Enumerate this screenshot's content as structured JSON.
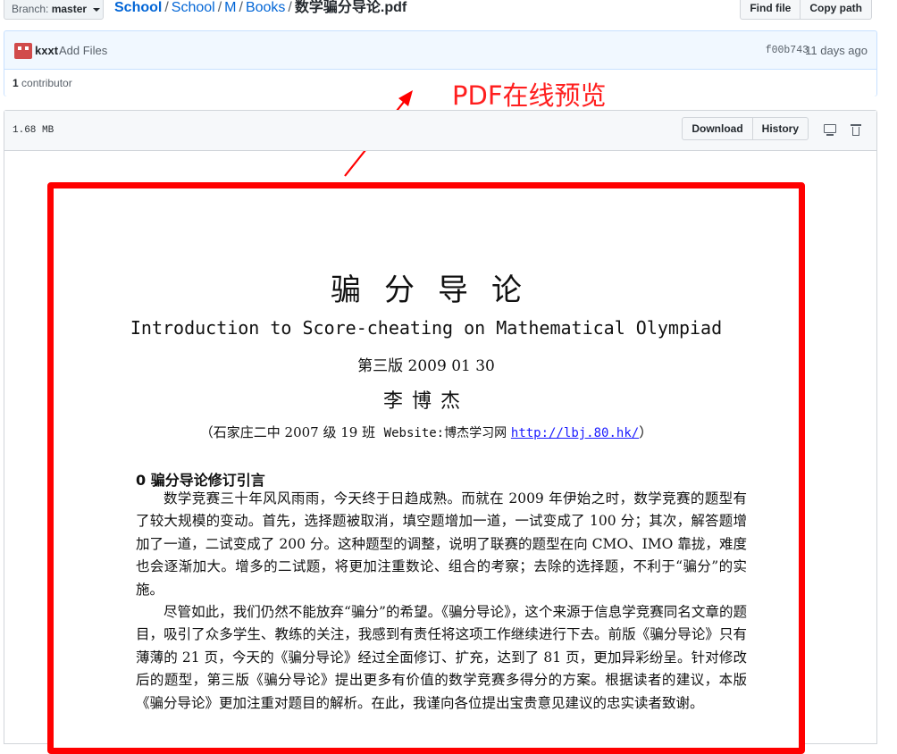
{
  "topbar": {
    "branch_prefix": "Branch:",
    "branch_name": "master",
    "breadcrumb_root": "School",
    "breadcrumb_items": [
      "School",
      "M",
      "Books"
    ],
    "breadcrumb_current": "数学骗分导论.pdf",
    "find_file_label": "Find file",
    "copy_path_label": "Copy path"
  },
  "commit": {
    "author": "kxxt",
    "message": "Add Files",
    "sha": "f00b743",
    "age": "11 days ago",
    "contributors_count": "1",
    "contributors_label": "contributor"
  },
  "file": {
    "size": "1.68 MB",
    "download_label": "Download",
    "history_label": "History",
    "icons": [
      "desktop-icon",
      "trash-icon"
    ]
  },
  "annotation": {
    "text": "PDF在线预览",
    "color": "#ff1f1f"
  },
  "pdf": {
    "title": "骗分导论",
    "subtitle": "Introduction to Score-cheating on Mathematical Olympiad",
    "edition": "第三版 2009 01 30",
    "author": "李博杰",
    "affiliation_prefix": "（石家庄二中 2007 级 19 班",
    "website_label": "Website:博杰学习网",
    "website_url": "http://lbj.80.hk/",
    "affiliation_suffix": "）",
    "section_title": "0  骗分导论修订引言",
    "paragraph_1": "数学竞赛三十年风风雨雨，今天终于日趋成熟。而就在 2009 年伊始之时，数学竞赛的题型有了较大规模的变动。首先，选择题被取消，填空题增加一道，一试变成了 100 分；其次，解答题增加了一道，二试变成了 200 分。这种题型的调整，说明了联赛的题型在向 CMO、IMO 靠拢，难度也会逐渐加大。增多的二试题，将更加注重数论、组合的考察；去除的选择题，不利于“骗分”的实施。",
    "paragraph_2": "尽管如此，我们仍然不能放弃“骗分”的希望。《骗分导论》，这个来源于信息学竞赛同名文章的题目，吸引了众多学生、教练的关注，我感到有责任将这项工作继续进行下去。前版《骗分导论》只有薄薄的 21 页，今天的《骗分导论》经过全面修订、扩充，达到了 81 页，更加异彩纷呈。针对修改后的题型，第三版《骗分导论》提出更多有价值的数学竞赛多得分的方案。根据读者的建议，本版《骗分导论》更加注重对题目的解析。在此，我谨向各位提出宝贵意见建议的忠实读者致谢。"
  }
}
